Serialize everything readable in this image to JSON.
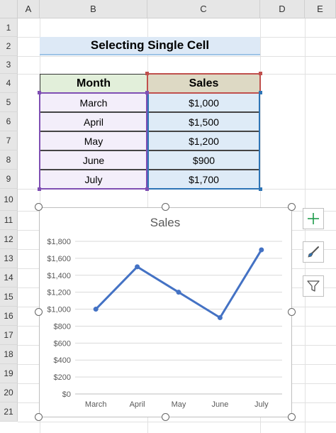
{
  "columns": [
    "A",
    "B",
    "C",
    "D",
    "E"
  ],
  "rows": [
    "1",
    "2",
    "3",
    "4",
    "5",
    "6",
    "7",
    "8",
    "9",
    "10",
    "11",
    "12",
    "13",
    "14",
    "15",
    "16",
    "17",
    "18",
    "19",
    "20",
    "21"
  ],
  "sheet_title": "Selecting Single Cell",
  "table": {
    "headers": {
      "month": "Month",
      "sales": "Sales"
    },
    "rows": [
      {
        "month": "March",
        "sales": "$1,000"
      },
      {
        "month": "April",
        "sales": "$1,500"
      },
      {
        "month": "May",
        "sales": "$1,200"
      },
      {
        "month": "June",
        "sales": "$900"
      },
      {
        "month": "July",
        "sales": "$1,700"
      }
    ]
  },
  "chart_data": {
    "type": "line",
    "title": "Sales",
    "categories": [
      "March",
      "April",
      "May",
      "June",
      "July"
    ],
    "series": [
      {
        "values": [
          1000,
          1500,
          1200,
          900,
          1700
        ]
      }
    ],
    "ylim": [
      0,
      1800
    ],
    "yticks": [
      "$0",
      "$200",
      "$400",
      "$600",
      "$800",
      "$1,000",
      "$1,200",
      "$1,400",
      "$1,600",
      "$1,800"
    ],
    "grid": true,
    "line_color": "#4472c4"
  },
  "chart_tools": [
    "plus-icon",
    "brush-icon",
    "filter-icon"
  ],
  "colors": {
    "purple_sel": "#7f4fb3",
    "blue_sel": "#2e75b6",
    "red_sel": "#c0504d",
    "plus_green": "#1e9b4b"
  }
}
